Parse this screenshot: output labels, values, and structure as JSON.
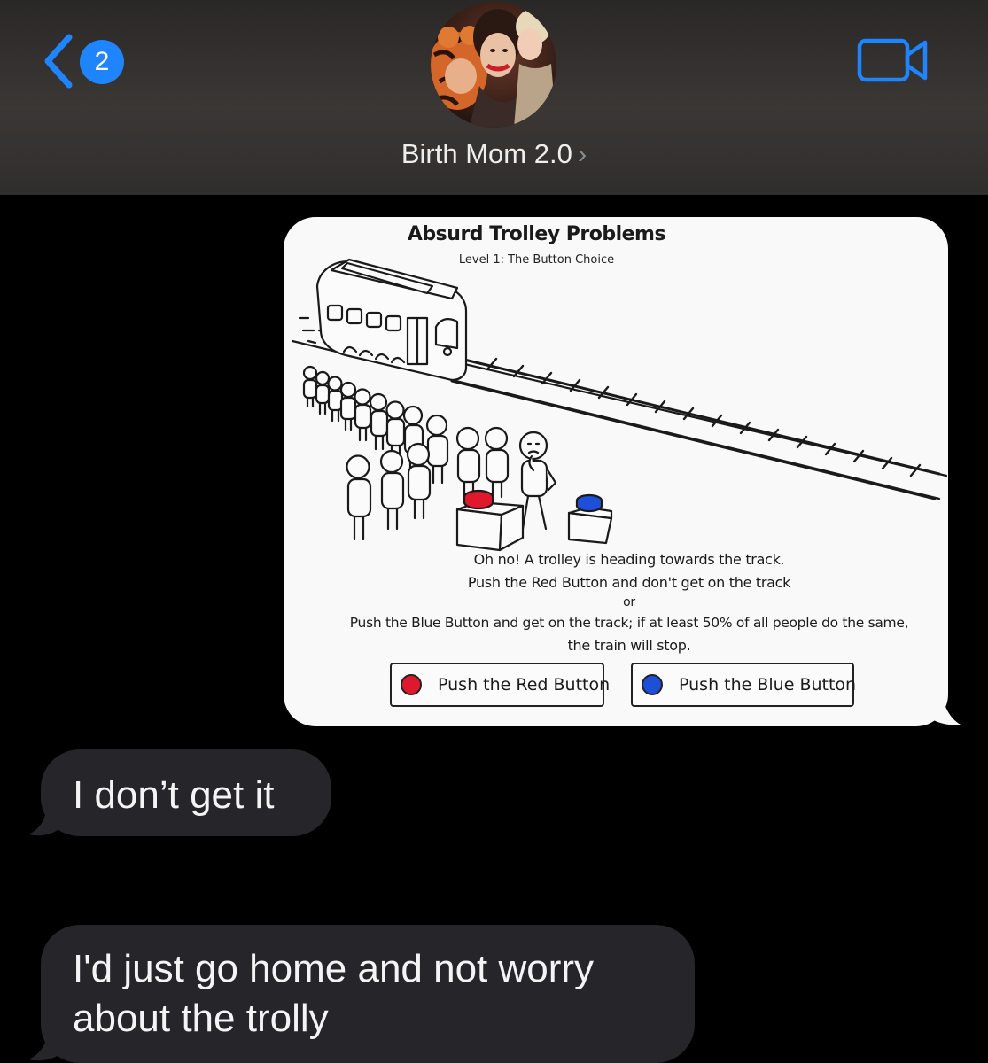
{
  "header": {
    "unread_count": "2",
    "contact_name": "Birth Mom 2.0",
    "chevron": "›",
    "icons": {
      "back": "chevron-left-icon",
      "video": "video-camera-icon"
    },
    "accent_color": "#1e85ff"
  },
  "attachment": {
    "title": "Absurd Trolley Problems",
    "subtitle": "Level 1: The Button Choice",
    "body_line_1": "Oh no! A trolley is heading towards the track.",
    "body_line_2": "Push the Red Button and don't get on the track",
    "body_line_3": "or",
    "body_line_4": "Push the Blue Button and get on the track; if at least 50% of all people do the same,",
    "body_line_5": "the train will stop.",
    "red_button_label": "Push the Red Button",
    "blue_button_label": "Push the Blue Button",
    "colors": {
      "red": "#e0182d",
      "blue": "#1f4fd8"
    }
  },
  "messages": [
    {
      "sender": "contact",
      "text": "I don’t get it"
    },
    {
      "sender": "contact",
      "text_line_1": "I'd just go home and not worry",
      "text_line_2": "about the trolly"
    }
  ],
  "colors": {
    "background": "#000000",
    "incoming_bubble": "#26252a"
  }
}
